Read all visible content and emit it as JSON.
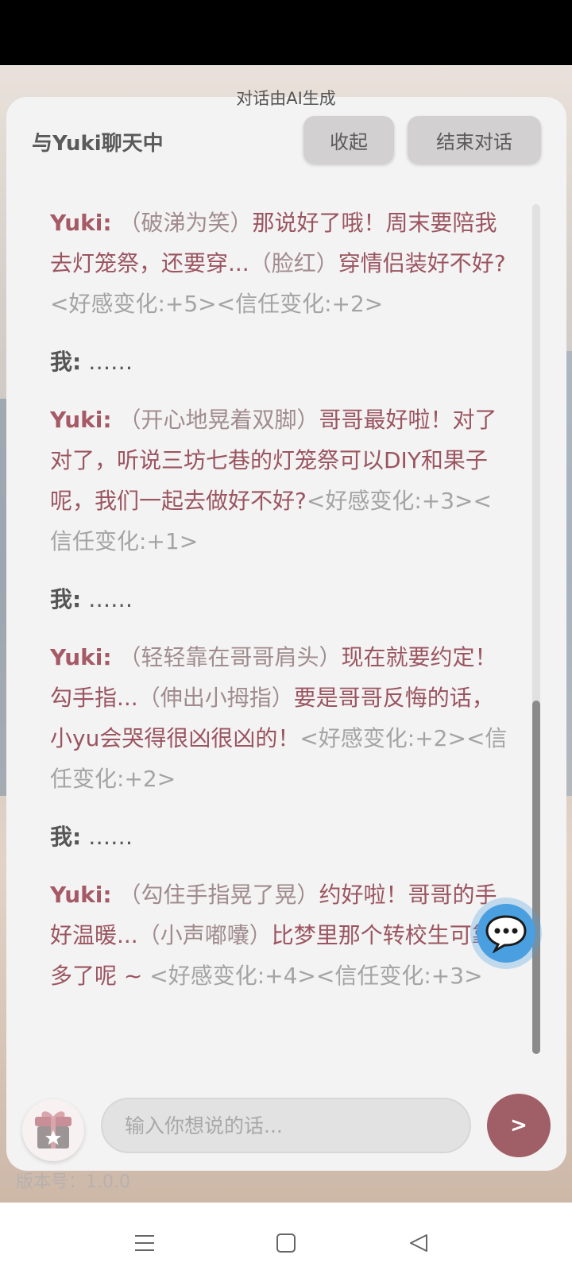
{
  "header": {
    "ai_note": "对话由AI生成",
    "title": "与Yuki聊天中",
    "collapse_label": "收起",
    "end_label": "结束对话"
  },
  "messages": [
    {
      "speaker": "Yuki:",
      "action": "（破涕为笑）",
      "text": "那说好了哦！周末要陪我去灯笼祭，还要穿...",
      "action2": "（脸红）",
      "text2": "穿情侣装好不好?",
      "tag": "<好感变化:+5><信任变化:+2>"
    },
    {
      "speaker": "我:",
      "text": "……"
    },
    {
      "speaker": "Yuki:",
      "action": "（开心地晃着双脚）",
      "text": "哥哥最好啦！对了对了，听说三坊七巷的灯笼祭可以DIY和果子呢，我们一起去做好不好?",
      "action2": "",
      "text2": "",
      "tag": "<好感变化:+3><信任变化:+1>"
    },
    {
      "speaker": "我:",
      "text": "……"
    },
    {
      "speaker": "Yuki:",
      "action": "（轻轻靠在哥哥肩头）",
      "text": "现在就要约定！勾手指...",
      "action2": "（伸出小拇指）",
      "text2": "要是哥哥反悔的话，小yu会哭得很凶很凶的！",
      "tag": "<好感变化:+2><信任变化:+2>"
    },
    {
      "speaker": "我:",
      "text": "……"
    },
    {
      "speaker": "Yuki:",
      "action": "（勾住手指晃了晃）",
      "text": "约好啦！哥哥的手好温暖...",
      "action2": "（小声嘟囔）",
      "text2": "比梦里那个转校生可靠多了呢 ~ ",
      "tag": "<好感变化:+4><信任变化:+3>"
    }
  ],
  "input": {
    "placeholder": "输入你想说的话..."
  },
  "send_label": ">",
  "version": "版本号：1.0.0",
  "icons": {
    "chat_float": "chat-bubble-icon",
    "gift": "gift-icon",
    "nav_menu": "menu-icon",
    "nav_home": "home-square-icon",
    "nav_back": "back-triangle-icon"
  },
  "colors": {
    "yuki_text": "#9a5560",
    "send_button": "#a05f66",
    "float_button": "#4a9fe0"
  }
}
